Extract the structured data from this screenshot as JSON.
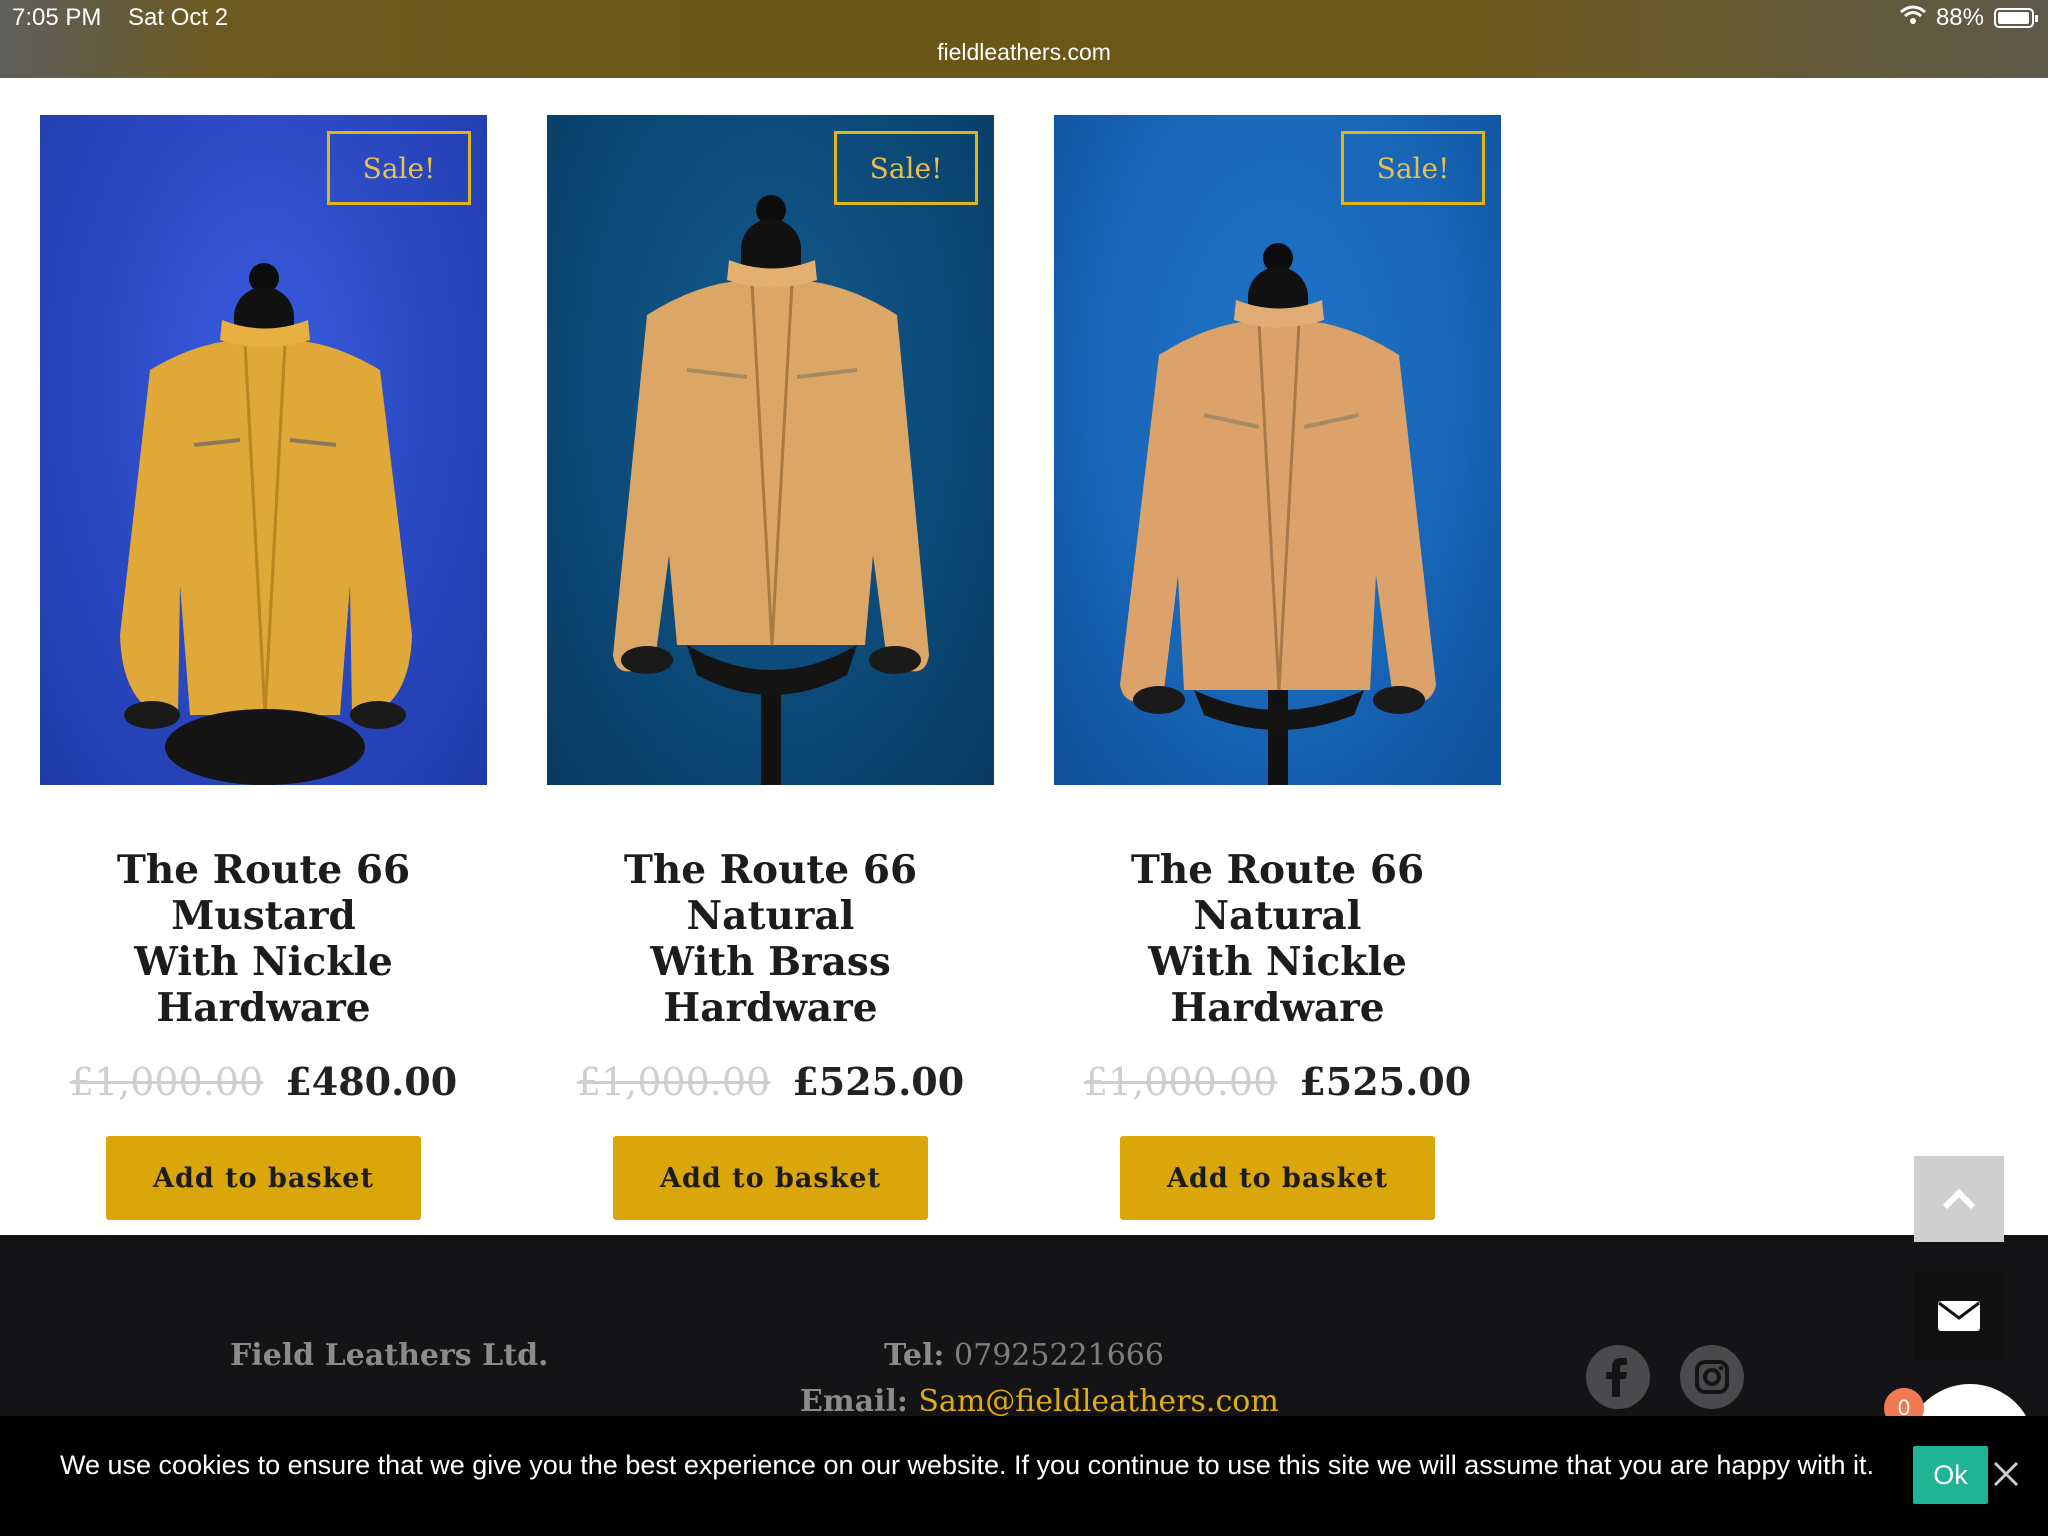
{
  "status_bar": {
    "time": "7:05 PM",
    "date": "Sat Oct 2",
    "url": "fieldleathers.com",
    "battery": "88%"
  },
  "products": [
    {
      "title_line1": "The Route 66 Mustard",
      "title_line2": "With Nickle Hardware",
      "old_price": "£1,000.00",
      "price": "£480.00",
      "badge": "Sale!",
      "button": "Add to basket",
      "jacket_color": "#e0a838",
      "bg_color": "#2a4fc8"
    },
    {
      "title_line1": "The Route 66 Natural",
      "title_line2": "With Brass Hardware",
      "old_price": "£1,000.00",
      "price": "£525.00",
      "badge": "Sale!",
      "button": "Add to basket",
      "jacket_color": "#dca766",
      "bg_color": "#0b4a78"
    },
    {
      "title_line1": "The Route 66 Natural",
      "title_line2": "With Nickle Hardware",
      "old_price": "£1,000.00",
      "price": "£525.00",
      "badge": "Sale!",
      "button": "Add to basket",
      "jacket_color": "#dba36a",
      "bg_color": "#1863b8"
    }
  ],
  "footer": {
    "company": "Field Leathers Ltd.",
    "tel_label": "Tel:",
    "tel": "07925221666",
    "email_label": "Email:",
    "email": "Sam@fieldleathers.com",
    "social": [
      "facebook-icon",
      "instagram-icon"
    ],
    "chat_count": "0"
  },
  "cookie": {
    "text": "We use cookies to ensure that we give you the best experience on our website. If you continue to use this site we will assume that you are happy with it.",
    "ok": "Ok"
  },
  "colors": {
    "accent": "#daa60a",
    "footer_bg": "#141416",
    "ok_button": "#1fb494",
    "link": "#e0ad10"
  }
}
